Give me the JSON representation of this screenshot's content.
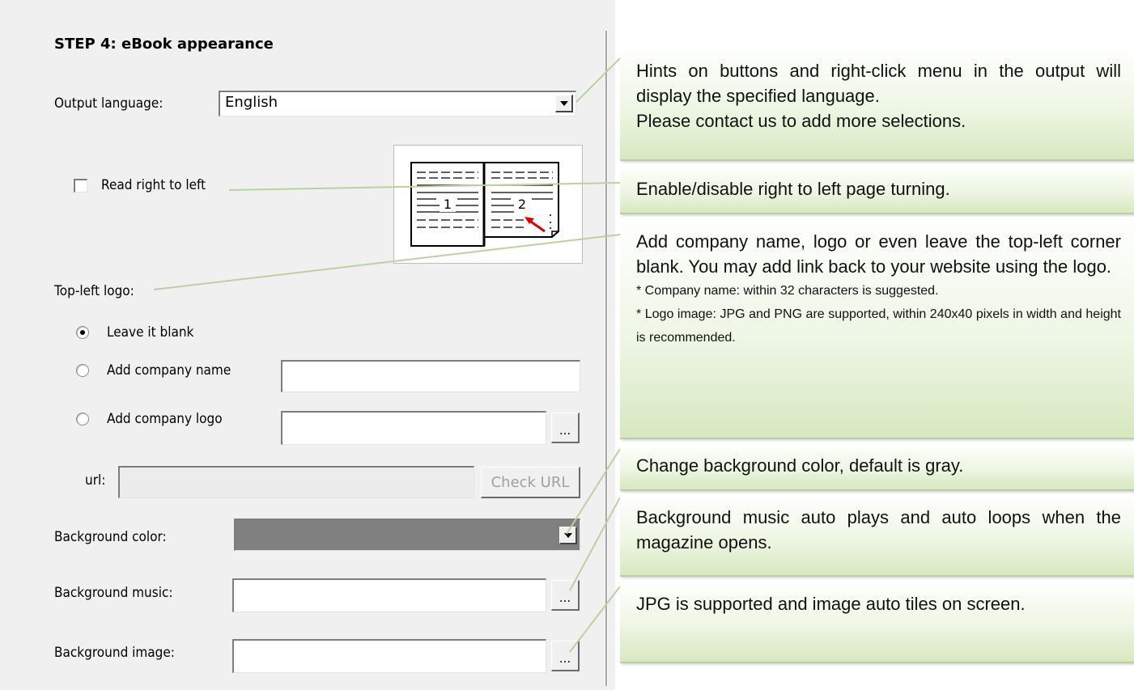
{
  "step_title": "STEP 4:  eBook appearance",
  "output_language": {
    "label": "Output language:",
    "value": "English"
  },
  "read_right_to_left": {
    "label": "Read right to left",
    "checked": false
  },
  "top_left_logo": {
    "label": "Top-left logo:",
    "options": [
      {
        "label": "Leave it blank",
        "selected": true
      },
      {
        "label": "Add company name",
        "selected": false
      },
      {
        "label": "Add company logo",
        "selected": false
      }
    ],
    "company_name_value": "",
    "company_logo_value": "",
    "browse_label": "..."
  },
  "url": {
    "label": "url:",
    "value": "",
    "check_button": "Check URL"
  },
  "background_color": {
    "label": "Background color:",
    "value_color": "#808080"
  },
  "background_music": {
    "label": "Background music:",
    "value": "",
    "browse_label": "..."
  },
  "background_image": {
    "label": "Background image:",
    "value": "",
    "browse_label": "..."
  },
  "preview": {
    "page_left": "1",
    "page_right": "2"
  },
  "hints": {
    "language": [
      "Hints on buttons and right-click menu in the output will display the specified language.",
      "Please contact us to add more selections."
    ],
    "rtl": "Enable/disable right to left page turning.",
    "logo": [
      "Add company name, logo or even leave the top-left corner blank. You may add link back to your website using the logo.",
      "* Company name: within 32 characters is suggested.",
      "* Logo image: JPG and PNG are supported, within 240x40 pixels in width and height is recommended."
    ],
    "bg_color": "Change background color, default is gray.",
    "bg_music": "Background music auto plays and auto loops when the magazine opens.",
    "bg_image": "JPG is supported and image auto tiles on screen."
  },
  "colors": {
    "panel": "#f0f0f0",
    "hint_gradient_end": "#d7e8c0",
    "connector": "#b9d29e",
    "arrow": "#e00000"
  }
}
